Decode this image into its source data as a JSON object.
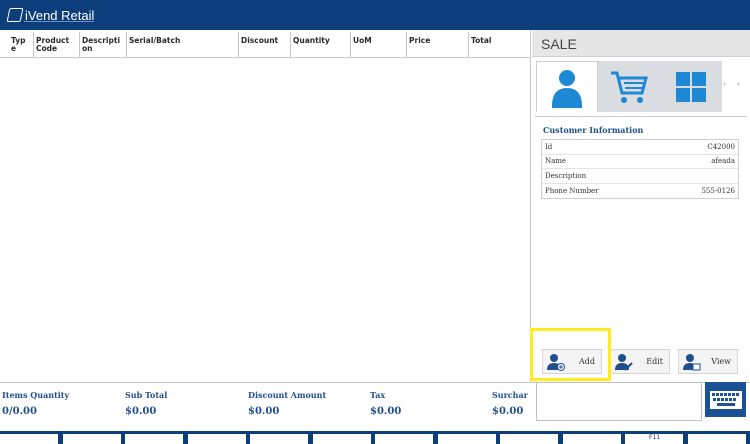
{
  "app": {
    "title": "iVend Retail"
  },
  "grid": {
    "columns": [
      "Type",
      "Product Code",
      "Description",
      "Serial/Batch",
      "Discount",
      "Quantity",
      "UoM",
      "Price",
      "Total"
    ],
    "column_display": [
      "Typ\ne",
      "Product\nCode",
      "Descripti\non",
      "Serial/Batch",
      "Discount",
      "Quantity",
      "UoM",
      "Price",
      "Total"
    ]
  },
  "sale_panel": {
    "title": "SALE",
    "tabs": [
      {
        "icon": "customer-icon",
        "active": true
      },
      {
        "icon": "cart-icon",
        "active": false
      },
      {
        "icon": "tiles-icon",
        "active": false
      }
    ],
    "tab_scroll": "‹  ›"
  },
  "customer_info": {
    "title": "Customer Information",
    "rows": [
      {
        "label": "Id",
        "value": "C42000"
      },
      {
        "label": "Name",
        "value": "afeada"
      },
      {
        "label": "Description",
        "value": ""
      },
      {
        "label": "Phone Number",
        "value": "555-0126"
      }
    ]
  },
  "actions": {
    "add": "Add",
    "edit": "Edit",
    "view": "View"
  },
  "totals": {
    "items_quantity_label": "Items Quantity",
    "items_quantity_value": "0/0.00",
    "subtotal_label": "Sub Total",
    "subtotal_value": "$0.00",
    "discount_label": "Discount Amount",
    "discount_value": "$0.00",
    "tax_label": "Tax",
    "tax_value": "$0.00",
    "surcharge_label": "Surchar",
    "surcharge_value": "$0.00"
  },
  "function_keys": [
    "",
    "",
    "",
    "",
    "",
    "",
    "",
    "",
    "",
    "",
    "F11",
    ""
  ],
  "colors": {
    "brand": "#0d3e7c",
    "accent_blue": "#1e88d4",
    "highlight": "#ffec1f",
    "label_blue": "#1f4f8c"
  }
}
